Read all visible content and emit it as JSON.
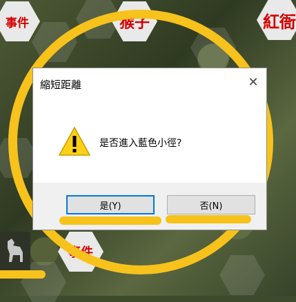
{
  "map": {
    "hexes": [
      {
        "label": "事件"
      },
      {
        "label": "猴子"
      },
      {
        "label": "紅衙"
      },
      {
        "label": "事件"
      }
    ]
  },
  "dialog": {
    "title": "縮短距離",
    "close_glyph": "✕",
    "message": "是否進入藍色小徑?",
    "icon": "warning-icon",
    "yes_label": "是(Y)",
    "no_label": "否(N)"
  },
  "colors": {
    "highlight": "#f7c21b",
    "map_text": "#d40000",
    "default_button_border": "#0078d7"
  }
}
